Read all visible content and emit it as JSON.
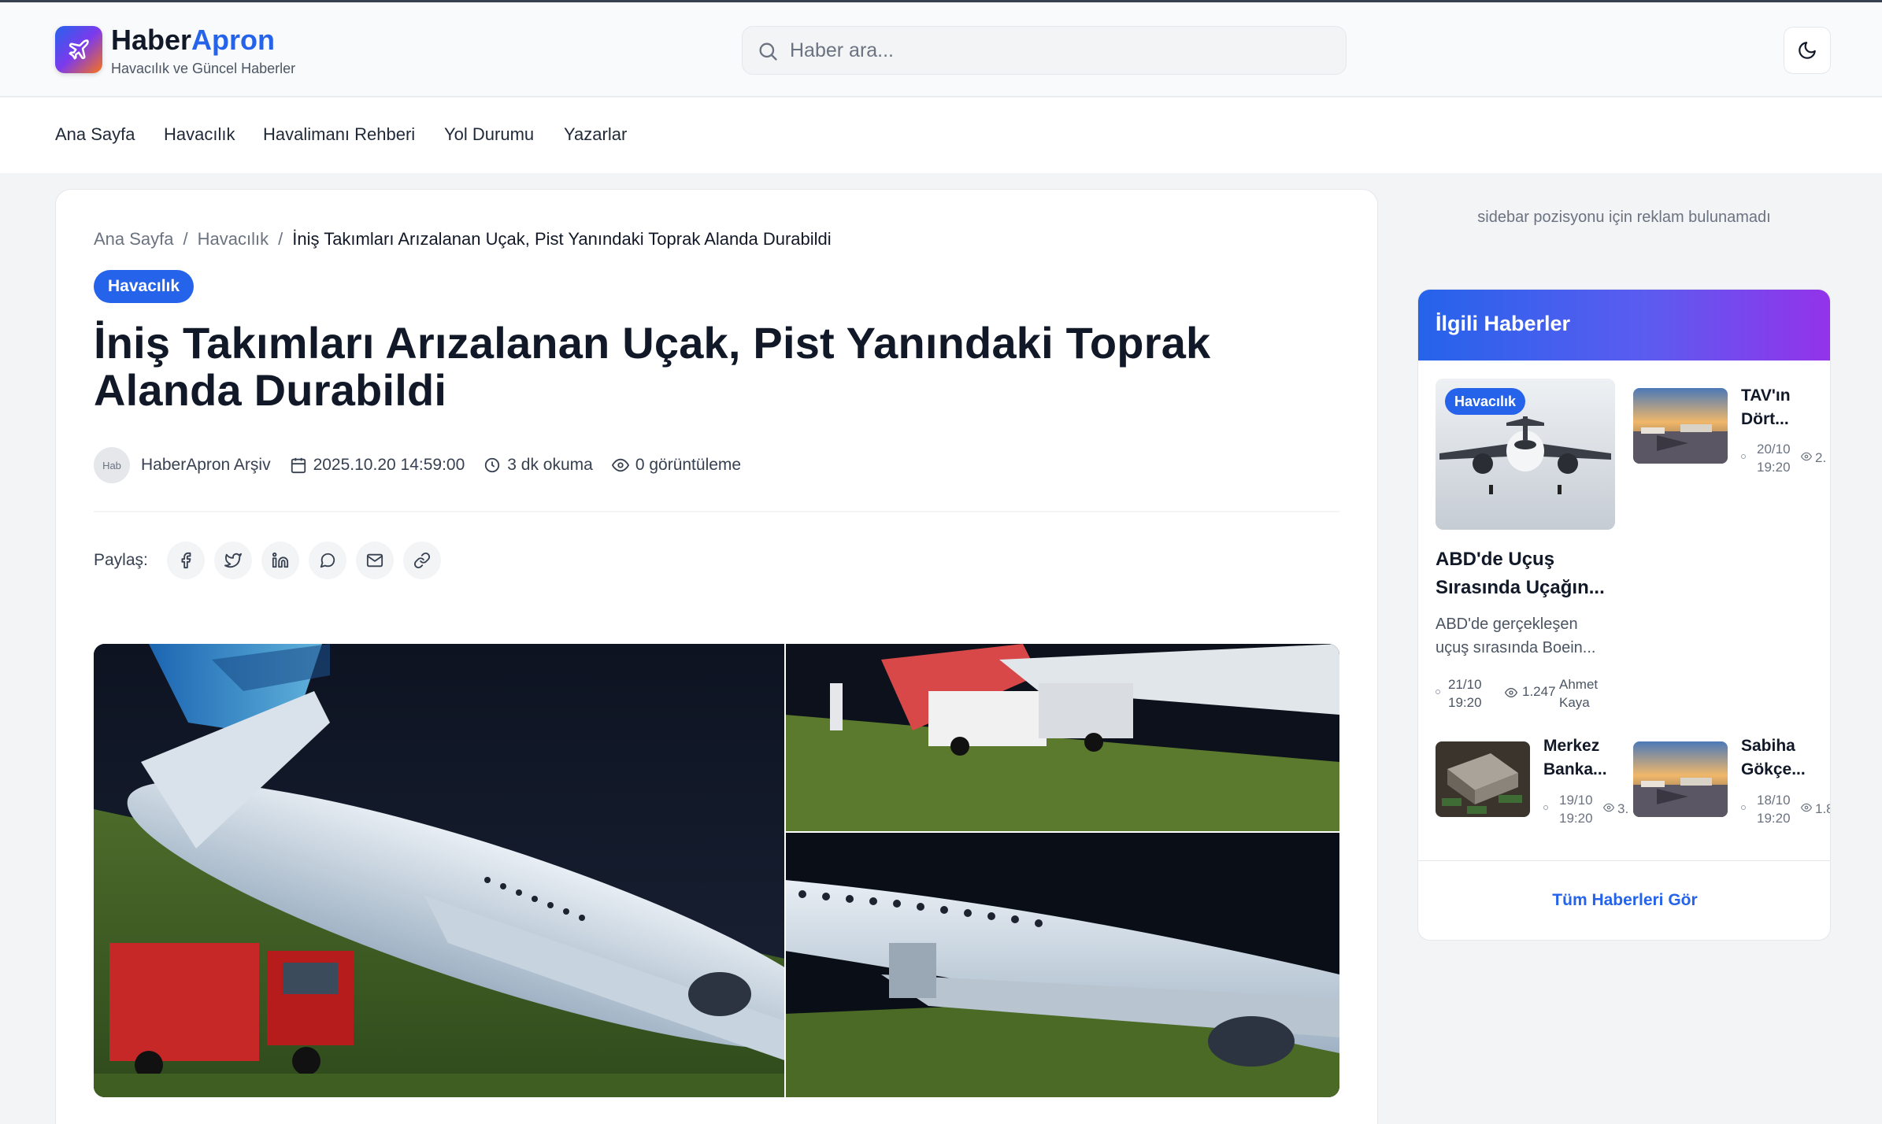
{
  "header": {
    "brand_part1": "Haber",
    "brand_part2": "Apron",
    "tagline": "Havacılık ve Güncel Haberler",
    "search_placeholder": "Haber ara..."
  },
  "nav": [
    "Ana Sayfa",
    "Havacılık",
    "Havalimanı Rehberi",
    "Yol Durumu",
    "Yazarlar"
  ],
  "article": {
    "breadcrumb": [
      "Ana Sayfa",
      "Havacılık",
      "İniş Takımları Arızalanan Uçak, Pist Yanındaki Toprak Alanda Durabildi"
    ],
    "category": "Havacılık",
    "title": "İniş Takımları Arızalanan Uçak, Pist Yanındaki Toprak Alanda Durabildi",
    "avatar_alt": "Hab",
    "author": "HaberApron Arşiv",
    "date": "2025.10.20 14:59:00",
    "read_time": "3 dk okuma",
    "views": "0 görüntüleme",
    "share_label": "Paylaş:",
    "share_icons": [
      "facebook-icon",
      "twitter-icon",
      "linkedin-icon",
      "whatsapp-icon",
      "mail-icon",
      "link-icon"
    ]
  },
  "sidebar": {
    "ad_text": "sidebar pozisyonu için reklam bulunamadı",
    "related_title": "İlgili Haberler",
    "featured": {
      "badge": "Havacılık",
      "title_line1": "ABD'de Uçuş",
      "title_line2": "Sırasında Uçağın...",
      "desc_line1": "ABD'de gerçekleşen",
      "desc_line2": "uçuş sırasında Boein...",
      "date_line1": "21/10",
      "date_line2": "19:20",
      "views": "1.247",
      "author_line1": "Ahmet",
      "author_line2": "Kaya"
    },
    "items": [
      {
        "title_line1": "TAV'ın",
        "title_line2": "Dört...",
        "date_line1": "20/10",
        "date_line2": "19:20",
        "views": "2."
      },
      {
        "title_line1": "Merkez",
        "title_line2": "Banka...",
        "date_line1": "19/10",
        "date_line2": "19:20",
        "views": "3."
      },
      {
        "title_line1": "Sabiha",
        "title_line2": "Gökçe...",
        "date_line1": "18/10",
        "date_line2": "19:20",
        "views": "1.8"
      }
    ],
    "all_news": "Tüm Haberleri Gör"
  },
  "colors": {
    "accent": "#2563eb",
    "gradient_end": "#9333ea"
  }
}
